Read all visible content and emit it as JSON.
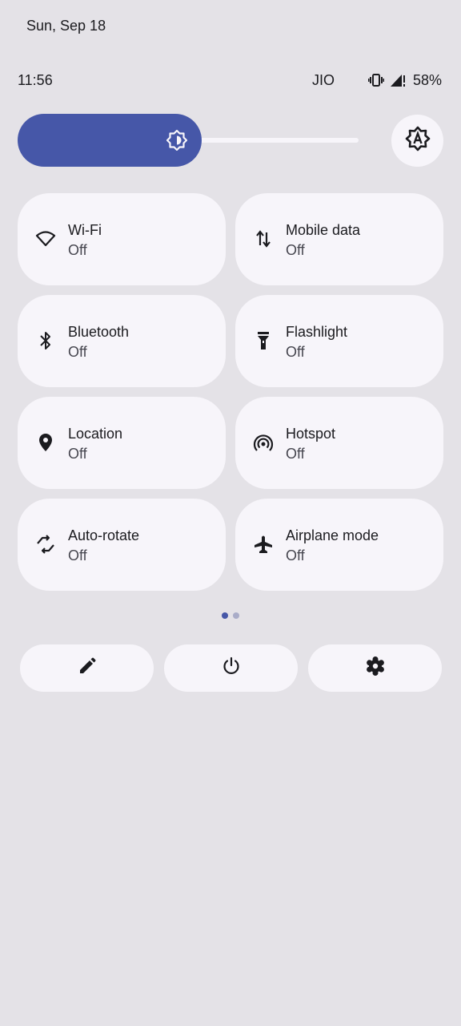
{
  "header": {
    "date": "Sun, Sep 18",
    "time": "11:56",
    "carrier": "JIO",
    "battery": "58%",
    "status_icons": [
      "vibrate-icon",
      "signal-no-data-icon"
    ]
  },
  "brightness": {
    "level_percent": 54,
    "thumb_icon": "brightness-icon",
    "auto_icon": "auto-brightness-icon"
  },
  "tiles": [
    {
      "label": "Wi-Fi",
      "state": "Off",
      "icon": "wifi-icon"
    },
    {
      "label": "Mobile data",
      "state": "Off",
      "icon": "mobile-data-icon"
    },
    {
      "label": "Bluetooth",
      "state": "Off",
      "icon": "bluetooth-icon"
    },
    {
      "label": "Flashlight",
      "state": "Off",
      "icon": "flashlight-icon"
    },
    {
      "label": "Location",
      "state": "Off",
      "icon": "location-icon"
    },
    {
      "label": "Hotspot",
      "state": "Off",
      "icon": "hotspot-icon"
    },
    {
      "label": "Auto-rotate",
      "state": "Off",
      "icon": "auto-rotate-icon"
    },
    {
      "label": "Airplane mode",
      "state": "Off",
      "icon": "airplane-icon"
    }
  ],
  "pager": {
    "pages": 2,
    "current": 1
  },
  "actions": [
    {
      "name": "edit",
      "icon": "pencil-icon"
    },
    {
      "name": "power",
      "icon": "power-icon"
    },
    {
      "name": "settings",
      "icon": "gear-icon"
    }
  ],
  "colors": {
    "background": "#e4e2e7",
    "surface": "#f7f5fa",
    "accent": "#4657a8",
    "pager_inactive": "#a9acc8",
    "text": "#1b1b1f",
    "text_secondary": "#46464f"
  }
}
